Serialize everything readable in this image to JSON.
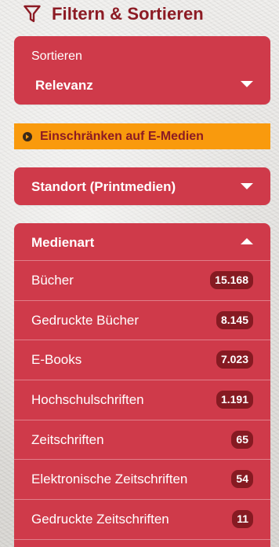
{
  "header": {
    "title": "Filtern & Sortieren",
    "icon": "filter-icon"
  },
  "sort": {
    "label": "Sortieren",
    "value": "Relevanz"
  },
  "restrict": {
    "label": "Einschränken auf E-Medien"
  },
  "standort": {
    "label": "Standort (Printmedien)"
  },
  "medienart": {
    "label": "Medienart",
    "items": [
      {
        "label": "Bücher",
        "count": "15.168"
      },
      {
        "label": "Gedruckte Bücher",
        "count": "8.145"
      },
      {
        "label": "E-Books",
        "count": "7.023"
      },
      {
        "label": "Hochschulschriften",
        "count": "1.191"
      },
      {
        "label": "Zeitschriften",
        "count": "65"
      },
      {
        "label": "Elektronische Zeitschriften",
        "count": "54"
      },
      {
        "label": "Gedruckte Zeitschriften",
        "count": "11"
      }
    ]
  },
  "colors": {
    "accent": "#cf3a4a",
    "dark": "#8c1b24",
    "highlight": "#f99a0d",
    "badge": "#861a22"
  }
}
